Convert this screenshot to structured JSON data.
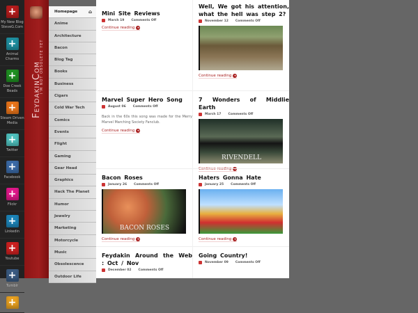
{
  "social": [
    {
      "label": "My New Blog SteveG.Com",
      "color": "#b51c1c",
      "icon": "plus-icon"
    },
    {
      "label": "Animal Charms",
      "color": "#1f8fa0",
      "icon": "plus-icon"
    },
    {
      "label": "Doe Creek Beads",
      "color": "#1f8f22",
      "icon": "plus-icon"
    },
    {
      "label": "Steam Driven Media",
      "color": "#e8741a",
      "icon": "plus-icon"
    },
    {
      "label": "Twitter",
      "color": "#4fc0bd",
      "icon": "plus-icon"
    },
    {
      "label": "Facebook",
      "color": "#3b6aa6",
      "icon": "plus-icon"
    },
    {
      "label": "Flickr",
      "color": "#e0188a",
      "icon": "plus-icon"
    },
    {
      "label": "Linkedin",
      "color": "#1c84b8",
      "icon": "plus-icon"
    },
    {
      "label": "Youtube",
      "color": "#cc2020",
      "icon": "plus-icon"
    },
    {
      "label": "Tumblr",
      "color": "#3a5a80",
      "icon": "plus-icon"
    },
    {
      "label": "",
      "color": "#e8a020",
      "icon": "plus-icon"
    }
  ],
  "brand": {
    "title": "FeydakinCom",
    "tagline": "I'm Not Obsolete Yet"
  },
  "nav": [
    "Homepage",
    "Anime",
    "Architecture",
    "Bacon",
    "Blog Tag",
    "Books",
    "Business",
    "Cigars",
    "Cold War Tech",
    "Comics",
    "Events",
    "Flight",
    "Gaming",
    "Gear Head",
    "Graphics",
    "Hack The Planet",
    "Humor",
    "Jewelry",
    "Marketing",
    "Motorcycle",
    "Music",
    "Obsolescence",
    "Outdoor Life"
  ],
  "continue_label": "Continue reading",
  "posts": [
    {
      "title": "Mini Site Reviews",
      "date": "March 19",
      "comments": "Comments Off"
    },
    {
      "title": "Well, We got his attention, what the hell was step 2?",
      "date": "November 12",
      "comments": "Comments Off",
      "image": "tank"
    },
    {
      "title": "Marvel Super Hero Song",
      "date": "August 06",
      "comments": "Comments Off",
      "excerpt": "Back in the 60s this song was made for the Merry Marvel Marching Society Fanclub."
    },
    {
      "title": "7 Wonders of Middlie Earth",
      "date": "March 17",
      "comments": "Comments Off",
      "image": "rivendell",
      "image_caption": "RIVENDELL"
    },
    {
      "title": "Bacon Roses",
      "date": "January 26",
      "comments": "Comments Off",
      "image": "bacon-roses",
      "image_caption": "BACON ROSES"
    },
    {
      "title": "Haters Gonna Hate",
      "date": "January 25",
      "comments": "Comments Off",
      "image": "mario"
    },
    {
      "title": "Feydakin Around the Web : Oct / Nov",
      "date": "December 02",
      "comments": "Comments Off"
    },
    {
      "title": "Going Country!",
      "date": "November 09",
      "comments": "Comments Off"
    }
  ]
}
